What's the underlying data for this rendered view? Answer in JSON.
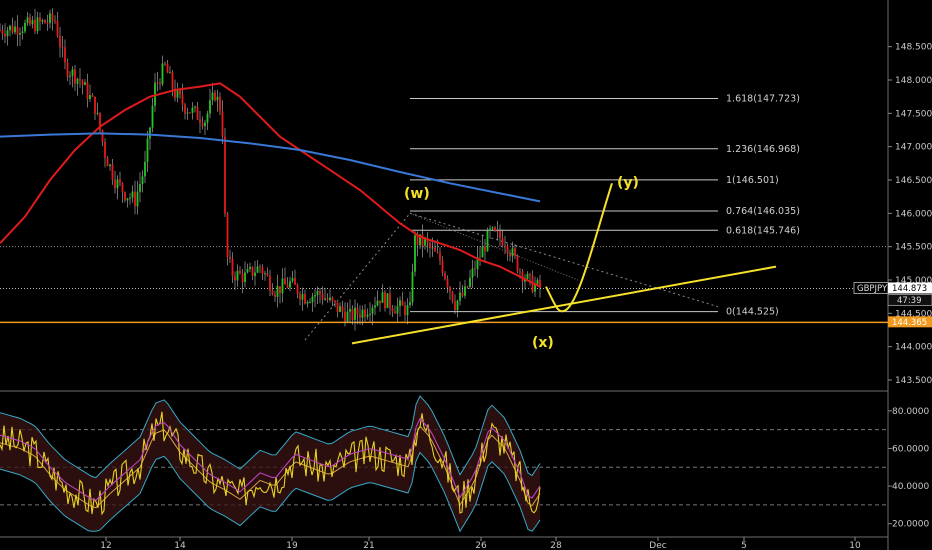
{
  "chart_data": [
    {
      "type": "candlestick",
      "symbol": "GBPJPY",
      "last_price": "144.873",
      "countdown": "47:39",
      "level_label": "144.365",
      "ylim": [
        143.35,
        149.2
      ],
      "y_ticks": [
        "143.500",
        "144.000",
        "144.500",
        "145.000",
        "145.500",
        "146.000",
        "146.500",
        "147.000",
        "147.500",
        "148.000",
        "148.500"
      ],
      "x_ticks": [
        "12",
        "14",
        "19",
        "21",
        "26",
        "28",
        "Dec",
        "5",
        "10"
      ],
      "fib_levels": [
        {
          "label": "1.618(147.723)",
          "value": 147.723
        },
        {
          "label": "1.236(146.968)",
          "value": 146.968
        },
        {
          "label": "1(146.501)",
          "value": 146.501
        },
        {
          "label": "0.764(146.035)",
          "value": 146.035
        },
        {
          "label": "0.618(145.746)",
          "value": 145.746
        },
        {
          "label": "0(144.525)",
          "value": 144.525
        }
      ],
      "wave_labels": [
        "(w)",
        "(x)",
        "(y)"
      ],
      "horizontal_levels": [
        145.5,
        144.873,
        144.365
      ],
      "series": [
        {
          "color": "#e01b1b",
          "values": [
            [
              0,
              145.55
            ],
            [
              25,
              145.95
            ],
            [
              50,
              146.5
            ],
            [
              75,
              146.95
            ],
            [
              100,
              147.3
            ],
            [
              125,
              147.55
            ],
            [
              150,
              147.75
            ],
            [
              175,
              147.85
            ],
            [
              200,
              147.9
            ],
            [
              220,
              147.95
            ],
            [
              240,
              147.75
            ],
            [
              260,
              147.45
            ],
            [
              280,
              147.15
            ],
            [
              300,
              146.95
            ],
            [
              320,
              146.75
            ],
            [
              340,
              146.55
            ],
            [
              360,
              146.35
            ],
            [
              380,
              146.1
            ],
            [
              400,
              145.85
            ],
            [
              420,
              145.65
            ],
            [
              440,
              145.55
            ],
            [
              460,
              145.45
            ],
            [
              480,
              145.3
            ],
            [
              500,
              145.2
            ],
            [
              520,
              145.05
            ],
            [
              540,
              144.9
            ]
          ]
        },
        {
          "color": "#3a78d6",
          "values": [
            [
              0,
              147.15
            ],
            [
              50,
              147.18
            ],
            [
              100,
              147.2
            ],
            [
              150,
              147.18
            ],
            [
              200,
              147.13
            ],
            [
              250,
              147.05
            ],
            [
              300,
              146.95
            ],
            [
              350,
              146.8
            ],
            [
              400,
              146.62
            ],
            [
              450,
              146.45
            ],
            [
              500,
              146.3
            ],
            [
              540,
              146.18
            ]
          ]
        }
      ]
    },
    {
      "type": "line",
      "name": "oscillator",
      "ylim": [
        14,
        90
      ],
      "y_ticks": [
        "20.0000",
        "40.0000",
        "60.0000",
        "80.0000"
      ],
      "levels": [
        30,
        50,
        70
      ]
    }
  ]
}
